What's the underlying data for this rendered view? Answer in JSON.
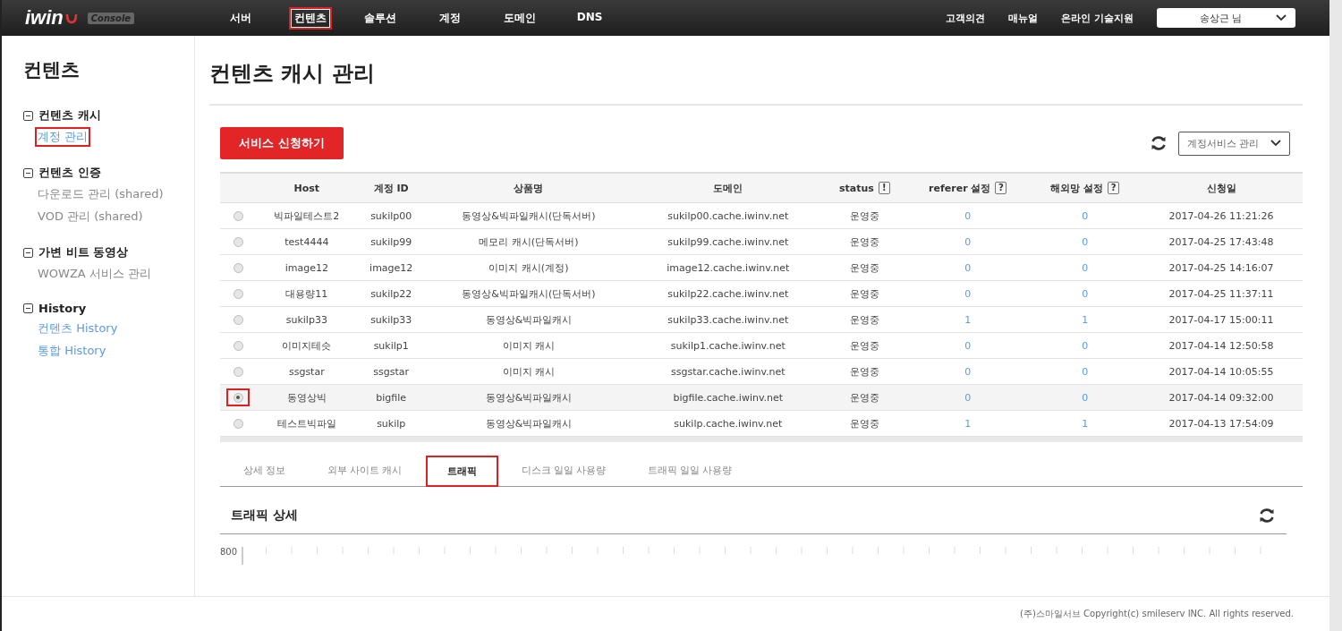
{
  "brand": {
    "logo": "iwin",
    "badge": "Console"
  },
  "nav": [
    {
      "label": "서버",
      "selected": false
    },
    {
      "label": "컨텐츠",
      "selected": true
    },
    {
      "label": "솔루션",
      "selected": false
    },
    {
      "label": "계정",
      "selected": false
    },
    {
      "label": "도메인",
      "selected": false
    },
    {
      "label": "DNS",
      "selected": false
    }
  ],
  "top_links": [
    "고객의견",
    "매뉴얼",
    "온라인 기술지원"
  ],
  "user_menu": "송상근 님",
  "sidebar": {
    "title": "컨텐츠",
    "groups": [
      {
        "label": "컨텐츠 캐시",
        "expanded": true,
        "items": [
          {
            "label": "계정 관리",
            "selected": true,
            "kind": "link"
          }
        ]
      },
      {
        "label": "컨텐츠 인증",
        "expanded": true,
        "items": [
          {
            "label": "다운로드 관리 (shared)",
            "selected": false,
            "kind": "plain"
          },
          {
            "label": "VOD 관리 (shared)",
            "selected": false,
            "kind": "plain"
          }
        ]
      },
      {
        "label": "가변 비트 동영상",
        "expanded": true,
        "items": [
          {
            "label": "WOWZA 서비스 관리",
            "selected": false,
            "kind": "plain"
          }
        ]
      },
      {
        "label": "History",
        "expanded": true,
        "items": [
          {
            "label": "컨텐츠 History",
            "selected": false,
            "kind": "link"
          },
          {
            "label": "통합 History",
            "selected": false,
            "kind": "link"
          }
        ]
      }
    ]
  },
  "page_title": "컨텐츠 캐시 관리",
  "apply_button": "서비스 신청하기",
  "service_select": "계정서비스 관리",
  "table": {
    "columns": [
      {
        "label": "Host"
      },
      {
        "label": "계정 ID"
      },
      {
        "label": "상품명"
      },
      {
        "label": "도메인"
      },
      {
        "label": "status",
        "hint": "!"
      },
      {
        "label": "referer 설정",
        "hint": "?"
      },
      {
        "label": "해외망 설정",
        "hint": "?"
      },
      {
        "label": "신청일"
      }
    ],
    "rows": [
      {
        "selected": false,
        "cells": [
          "빅파일테스트2",
          "sukilp00",
          "동영상&빅파일캐시(단독서버)",
          "sukilp00.cache.iwinv.net",
          "운영중",
          "0",
          "0",
          "2017-04-26 11:21:26"
        ]
      },
      {
        "selected": false,
        "cells": [
          "test4444",
          "sukilp99",
          "메모리 캐시(단독서버)",
          "sukilp99.cache.iwinv.net",
          "운영중",
          "0",
          "0",
          "2017-04-25 17:43:48"
        ]
      },
      {
        "selected": false,
        "cells": [
          "image12",
          "image12",
          "이미지 캐시(계정)",
          "image12.cache.iwinv.net",
          "운영중",
          "0",
          "0",
          "2017-04-25 14:16:07"
        ]
      },
      {
        "selected": false,
        "cells": [
          "대용량11",
          "sukilp22",
          "동영상&빅파일캐시(단독서버)",
          "sukilp22.cache.iwinv.net",
          "운영중",
          "0",
          "0",
          "2017-04-25 11:37:11"
        ]
      },
      {
        "selected": false,
        "cells": [
          "sukilp33",
          "sukilp33",
          "동영상&빅파일캐시",
          "sukilp33.cache.iwinv.net",
          "운영중",
          "1",
          "1",
          "2017-04-17 15:00:11"
        ]
      },
      {
        "selected": false,
        "cells": [
          "이미지테슷",
          "sukilp1",
          "이미지 캐시",
          "sukilp1.cache.iwinv.net",
          "운영중",
          "0",
          "0",
          "2017-04-14 12:50:58"
        ]
      },
      {
        "selected": false,
        "cells": [
          "ssgstar",
          "ssgstar",
          "이미지 캐시",
          "ssgstar.cache.iwinv.net",
          "운영중",
          "0",
          "0",
          "2017-04-14 10:05:55"
        ]
      },
      {
        "selected": true,
        "cells": [
          "동영상빅",
          "bigfile",
          "동영상&빅파일캐시",
          "bigfile.cache.iwinv.net",
          "운영중",
          "0",
          "0",
          "2017-04-14 09:32:00"
        ]
      },
      {
        "selected": false,
        "cells": [
          "테스트빅파일",
          "sukilp",
          "동영상&빅파일캐시",
          "sukilp.cache.iwinv.net",
          "운영중",
          "1",
          "1",
          "2017-04-13 17:54:09"
        ]
      }
    ]
  },
  "detail_tabs": [
    {
      "label": "상세 정보",
      "selected": false
    },
    {
      "label": "외부 사이트 캐시",
      "selected": false
    },
    {
      "label": "트래픽",
      "selected": true
    },
    {
      "label": "디스크 일일 사용량",
      "selected": false
    },
    {
      "label": "트래픽 일일 사용량",
      "selected": false
    }
  ],
  "section_title": "트래픽 상세",
  "chart": {
    "y_tick": "800"
  },
  "footer": "(주)스마일서브 Copyright(c) smileserv INC. All rights reserved."
}
